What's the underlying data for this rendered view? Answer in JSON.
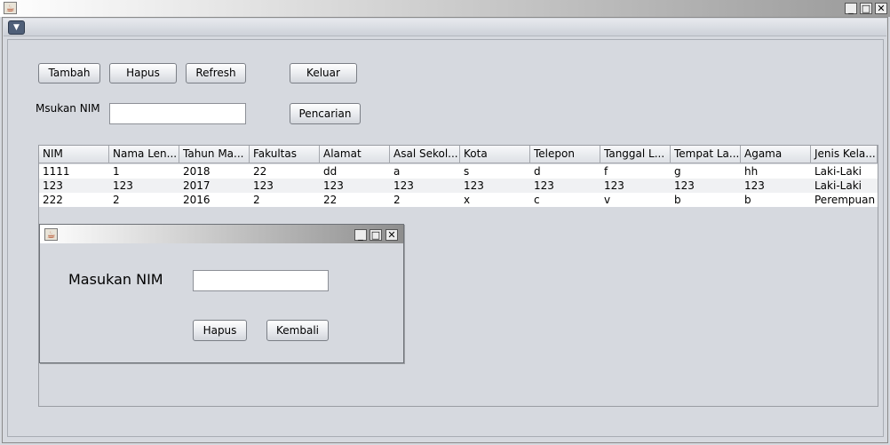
{
  "window": {
    "icon": "java-cup-icon",
    "controls": [
      "minimize-icon",
      "maximize-icon",
      "close-icon"
    ]
  },
  "internal_frame": {
    "menu_icon": "dropdown-arrow-icon"
  },
  "toolbar": {
    "tambah_label": "Tambah",
    "hapus_label": "Hapus",
    "refresh_label": "Refresh",
    "keluar_label": "Keluar",
    "pencarian_label": "Pencarian"
  },
  "search": {
    "label": "Msukan NIM",
    "value": ""
  },
  "table": {
    "columns": [
      "NIM",
      "Nama Len...",
      "Tahun Ma...",
      "Fakultas",
      "Alamat",
      "Asal Sekol...",
      "Kota",
      "Telepon",
      "Tanggal L...",
      "Tempat La...",
      "Agama",
      "Jenis Kela..."
    ],
    "rows": [
      [
        "1111",
        "1",
        "2018",
        "22",
        "dd",
        "a",
        "s",
        "d",
        "f",
        "g",
        "hh",
        "Laki-Laki"
      ],
      [
        "123",
        "123",
        "2017",
        "123",
        "123",
        "123",
        "123",
        "123",
        "123",
        "123",
        "123",
        "Laki-Laki"
      ],
      [
        "222",
        "2",
        "2016",
        "2",
        "22",
        "2",
        "x",
        "c",
        "v",
        "b",
        "b",
        "Perempuan"
      ]
    ]
  },
  "dialog": {
    "icon": "java-cup-icon",
    "prompt_label": "Masukan NIM",
    "input_value": "",
    "hapus_label": "Hapus",
    "kembali_label": "Kembali"
  }
}
